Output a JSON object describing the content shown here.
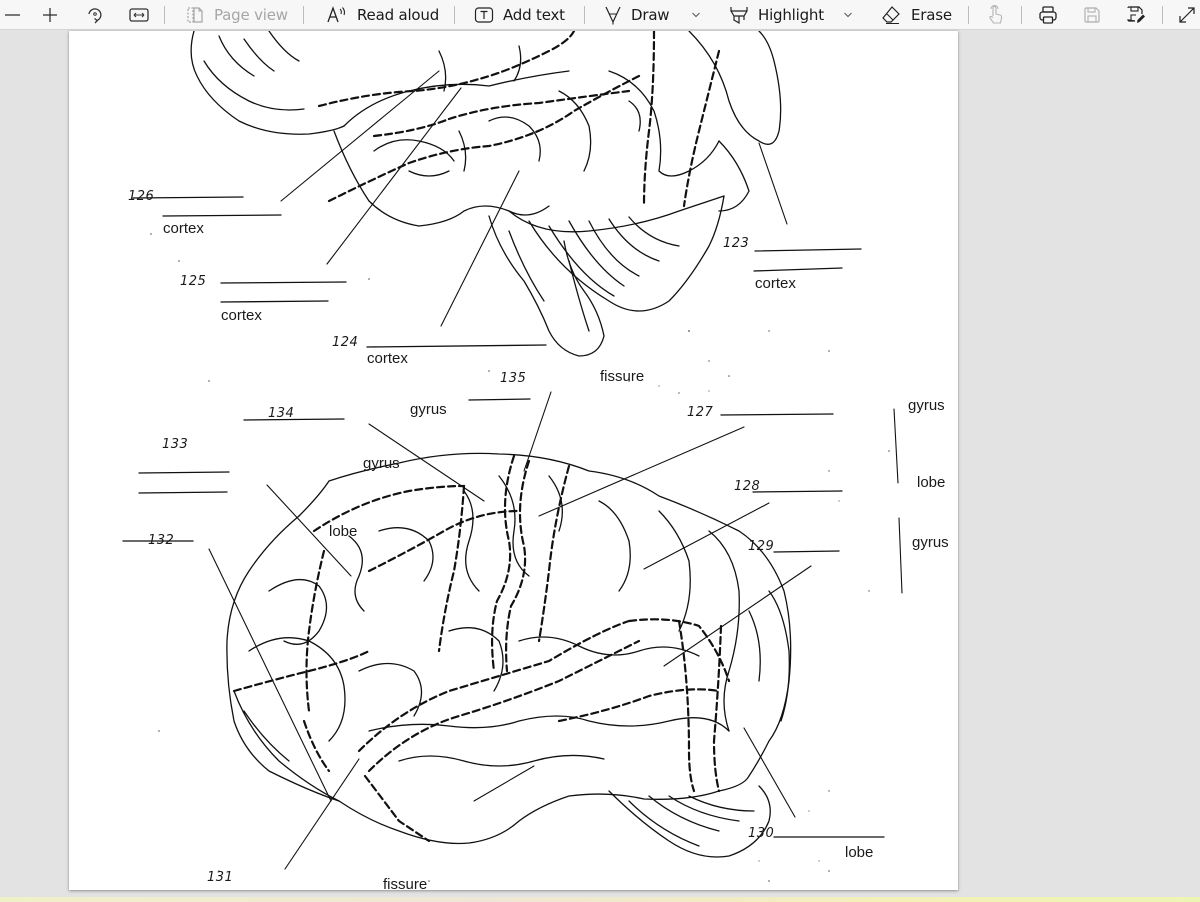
{
  "toolbar": {
    "zoom_out_icon": "minus-icon",
    "zoom_in_icon": "plus-icon",
    "rotate_icon": "rotate-icon",
    "fit_width_icon": "fit-width-icon",
    "page_view": {
      "label": "Page view",
      "icon": "page-view-icon",
      "disabled": true
    },
    "read_aloud": {
      "label": "Read aloud",
      "icon": "read-aloud-icon"
    },
    "add_text": {
      "label": "Add text",
      "icon": "text-box-icon"
    },
    "draw": {
      "label": "Draw",
      "icon": "pen-icon",
      "has_dropdown": true
    },
    "highlight": {
      "label": "Highlight",
      "icon": "highlighter-icon",
      "has_dropdown": true
    },
    "erase": {
      "label": "Erase",
      "icon": "eraser-icon"
    },
    "touch_write_icon": "touch-hand-icon",
    "print_icon": "print-icon",
    "save_icon": "save-icon",
    "save_as_icon": "save-as-icon",
    "fullscreen_icon": "expand-icon"
  },
  "document": {
    "top_diagram_labels": [
      {
        "number": "126",
        "suffix": "cortex"
      },
      {
        "number": "125",
        "suffix": "cortex"
      },
      {
        "number": "124",
        "suffix": "cortex"
      },
      {
        "number": "123",
        "suffix": "cortex"
      }
    ],
    "bottom_diagram_labels": [
      {
        "number": "135",
        "suffix": "fissure"
      },
      {
        "number": "134",
        "suffix": "gyrus"
      },
      {
        "number": "133",
        "suffix": "gyrus"
      },
      {
        "number": "132",
        "suffix": "lobe"
      },
      {
        "number": "131",
        "suffix": "fissure"
      },
      {
        "number": "127",
        "suffix": "gyrus"
      },
      {
        "number": "128",
        "suffix": "lobe"
      },
      {
        "number": "129",
        "suffix": "gyrus"
      },
      {
        "number": "130",
        "suffix": "lobe"
      }
    ]
  },
  "colors": {
    "toolbar_bg": "#f7f7f7",
    "canvas_bg": "#e3e3e3",
    "page_bg": "#ffffff",
    "ink": "#1a1a1a",
    "disabled": "#a6a6a6"
  }
}
